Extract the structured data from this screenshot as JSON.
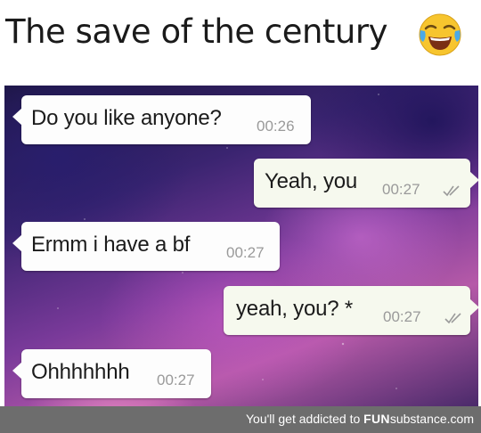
{
  "caption": {
    "title": "The save of the century",
    "emoji": "face-with-tears-of-joy-icon"
  },
  "messages": [
    {
      "text": "Do you like anyone?",
      "time": "00:26",
      "direction": "incoming"
    },
    {
      "text": "Yeah, you",
      "time": "00:27",
      "direction": "outgoing",
      "status": "double-check-icon"
    },
    {
      "text": "Ermm i have a bf",
      "time": "00:27",
      "direction": "incoming"
    },
    {
      "text": "yeah, you? *",
      "time": "00:27",
      "direction": "outgoing",
      "status": "double-check-icon"
    },
    {
      "text": "Ohhhhhhh",
      "time": "00:27",
      "direction": "incoming"
    }
  ],
  "footer": {
    "prefix": "You'll get addicted to",
    "brand_fun": "FUN",
    "brand_rest": "substance",
    "brand_domain": ".com"
  },
  "colors": {
    "incoming_bubble": "#fdfdfd",
    "outgoing_bubble": "#f6f9ee",
    "timestamp": "#9a9a9a",
    "footer_bg": "#6d6d6d"
  }
}
